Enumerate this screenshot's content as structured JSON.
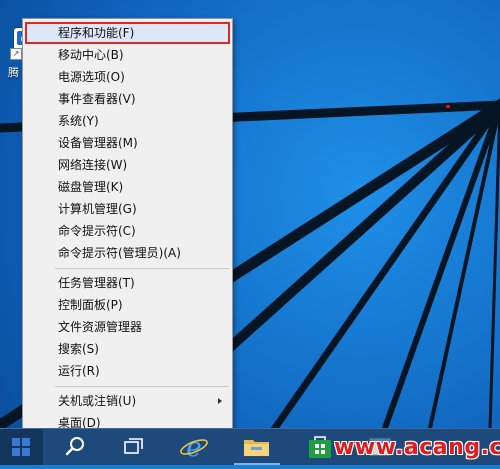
{
  "desktop": {
    "icons": [
      {
        "label": "腾",
        "shortcut_glyph": "↗"
      }
    ]
  },
  "context_menu": {
    "groups": [
      {
        "items": [
          {
            "name": "programs-and-features",
            "label": "程序和功能(F)",
            "highlighted": true
          },
          {
            "name": "mobility-center",
            "label": "移动中心(B)"
          },
          {
            "name": "power-options",
            "label": "电源选项(O)"
          },
          {
            "name": "event-viewer",
            "label": "事件查看器(V)"
          },
          {
            "name": "system",
            "label": "系统(Y)"
          },
          {
            "name": "device-manager",
            "label": "设备管理器(M)"
          },
          {
            "name": "network-connections",
            "label": "网络连接(W)"
          },
          {
            "name": "disk-management",
            "label": "磁盘管理(K)"
          },
          {
            "name": "computer-management",
            "label": "计算机管理(G)"
          },
          {
            "name": "command-prompt",
            "label": "命令提示符(C)"
          },
          {
            "name": "command-prompt-admin",
            "label": "命令提示符(管理员)(A)"
          }
        ]
      },
      {
        "items": [
          {
            "name": "task-manager",
            "label": "任务管理器(T)"
          },
          {
            "name": "control-panel",
            "label": "控制面板(P)"
          },
          {
            "name": "file-explorer",
            "label": "文件资源管理器"
          },
          {
            "name": "search",
            "label": "搜索(S)"
          },
          {
            "name": "run",
            "label": "运行(R)"
          }
        ]
      },
      {
        "items": [
          {
            "name": "shutdown-or-sign-out",
            "label": "关机或注销(U)",
            "submenu": true
          },
          {
            "name": "desktop",
            "label": "桌面(D)"
          }
        ]
      }
    ]
  },
  "taskbar": {
    "buttons": [
      {
        "name": "start-button",
        "icon": "windows-logo-icon"
      },
      {
        "name": "search-button",
        "icon": "search-icon"
      },
      {
        "name": "task-view-button",
        "icon": "task-view-icon"
      },
      {
        "name": "internet-explorer-button",
        "icon": "internet-explorer-icon"
      },
      {
        "name": "file-explorer-button",
        "icon": "folder-icon"
      },
      {
        "name": "store-button",
        "icon": "store-icon"
      },
      {
        "name": "app-button",
        "icon": "app-window-icon"
      }
    ]
  },
  "watermark": {
    "text": "www.acang.cn"
  },
  "colors": {
    "highlight_background": "#dce7f7",
    "highlight_border": "#e02727",
    "taskbar": "#1d4a7a",
    "watermark": "#e01d1d"
  }
}
